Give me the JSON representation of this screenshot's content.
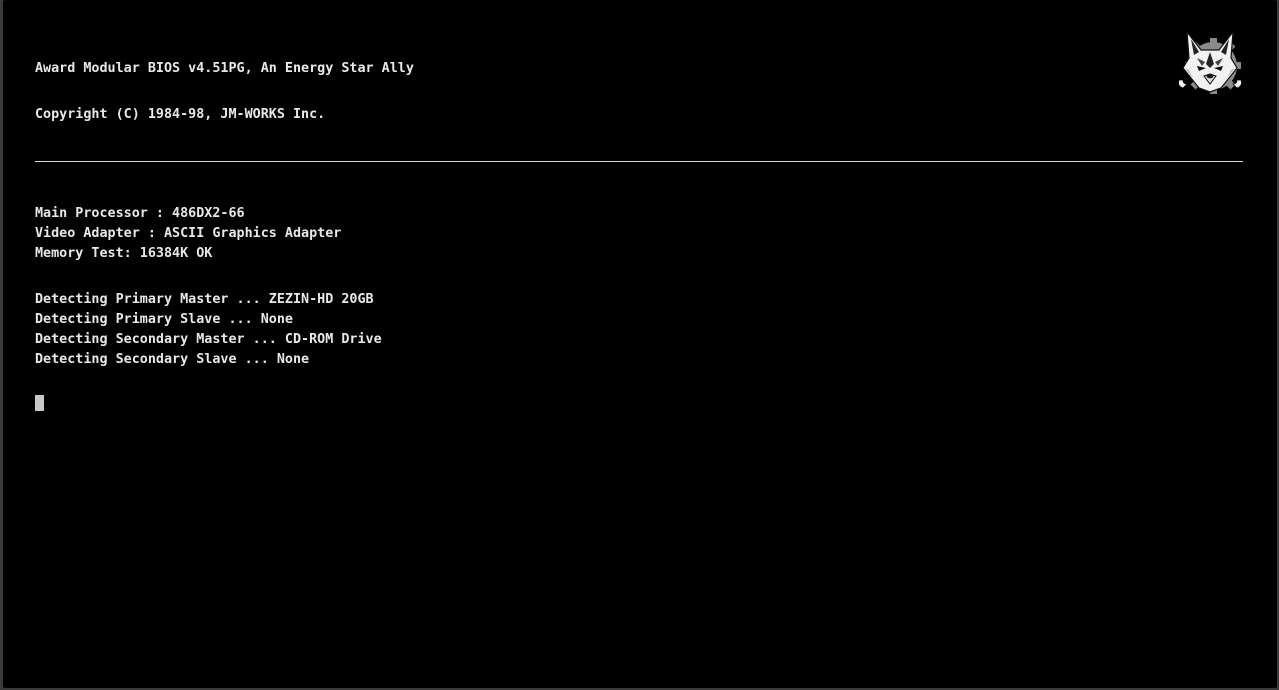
{
  "bios": {
    "header": {
      "title_line": "Award Modular BIOS v4.51PG, An Energy Star Ally",
      "copyright_line": "Copyright (C) 1984-98, JM-WORKS Inc."
    },
    "system_info": [
      "Main Processor : 486DX2-66",
      "Video Adapter : ASCII Graphics Adapter",
      "Memory Test: 16384K OK"
    ],
    "drive_detection": [
      "Detecting Primary Master ... ZEZIN-HD 20GB",
      "Detecting Primary Slave ... None",
      "Detecting Secondary Master ... CD-ROM Drive",
      "Detecting Secondary Slave ... None"
    ],
    "logo_icon": "fox-gear-logo-icon"
  },
  "colors": {
    "background": "#000000",
    "text": "#e8e8e8",
    "cursor": "#c8c8c8"
  }
}
